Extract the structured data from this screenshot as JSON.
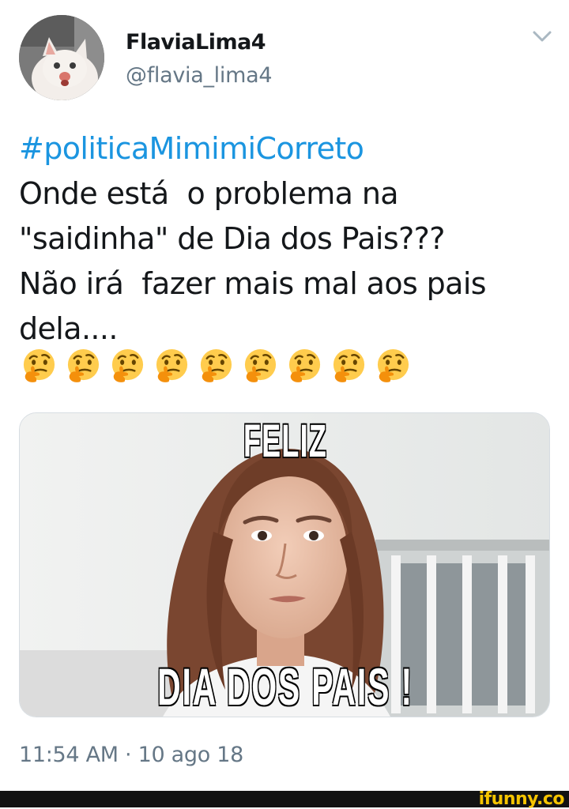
{
  "user": {
    "display_name": "FlaviaLima4",
    "handle": "@flavia_lima4"
  },
  "tweet": {
    "hashtag": "#politicaMimimiCorreto",
    "lines": [
      "Onde está  o problema na",
      "\"saidinha\" de Dia dos Pais???",
      "Não irá  fazer mais mal aos pais",
      "dela...."
    ],
    "emoji_name": "thinking-face",
    "emoji_count": 9
  },
  "media": {
    "top_caption": "FELIZ",
    "bottom_caption": "DIA DOS PAIS !"
  },
  "timestamp": "11:54 AM · 10 ago 18",
  "watermark": "ifunny.co",
  "colors": {
    "hashtag": "#1b95e0",
    "secondary_text": "#657786",
    "primary_text": "#14171a",
    "watermark": "#f5c400"
  }
}
